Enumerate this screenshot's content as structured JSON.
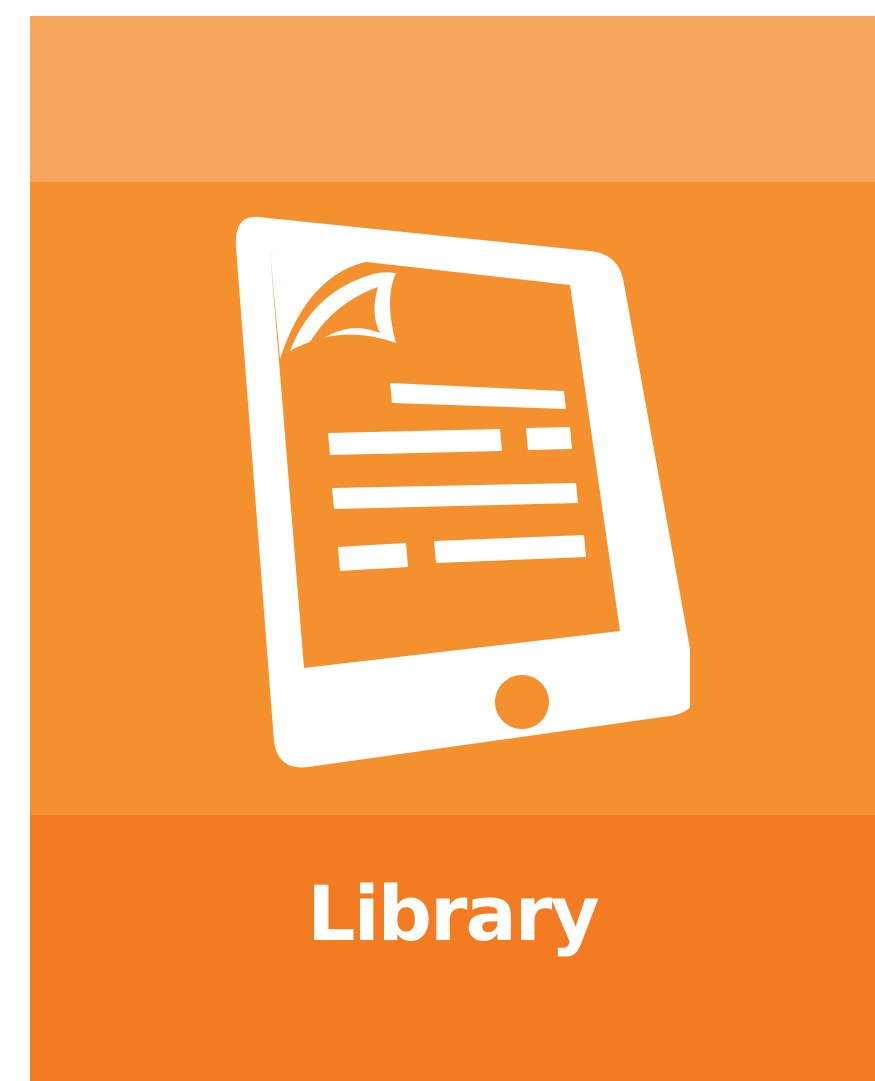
{
  "tile": {
    "label": "Library",
    "icon": "ebook-reader-icon",
    "colors": {
      "top_band": "#f7a55c",
      "middle_band": "#f5902e",
      "bottom_band": "#f37b22",
      "foreground": "#ffffff"
    }
  }
}
